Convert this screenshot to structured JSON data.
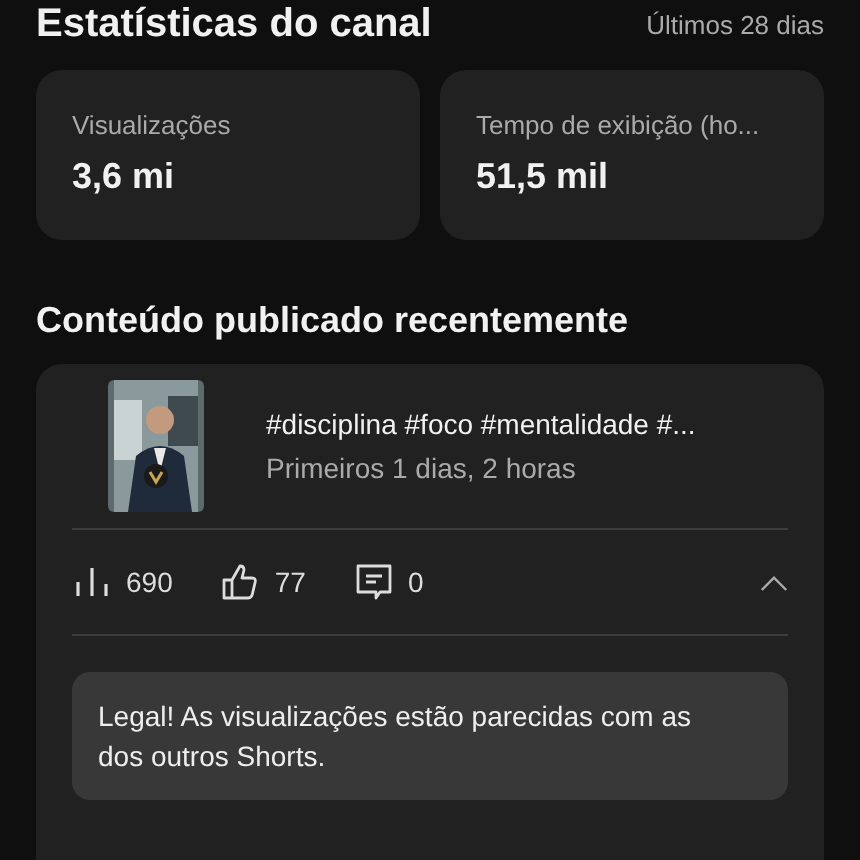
{
  "header": {
    "title": "Estatísticas do canal",
    "period": "Últimos 28 dias"
  },
  "stats": [
    {
      "label": "Visualizações",
      "value": "3,6 mi"
    },
    {
      "label": "Tempo de exibição (ho...",
      "value": "51,5 mil"
    }
  ],
  "recent": {
    "title": "Conteúdo publicado recentemente",
    "video": {
      "title": "#disciplina #foco #mentalidade #...",
      "age": "Primeiros 1 dias, 2 horas"
    },
    "metrics": [
      {
        "kind": "views",
        "value": "690"
      },
      {
        "kind": "likes",
        "value": "77"
      },
      {
        "kind": "comments",
        "value": "0"
      }
    ],
    "expanded": true,
    "message": "Legal! As visualizações estão parecidas com as dos outros Shorts."
  }
}
